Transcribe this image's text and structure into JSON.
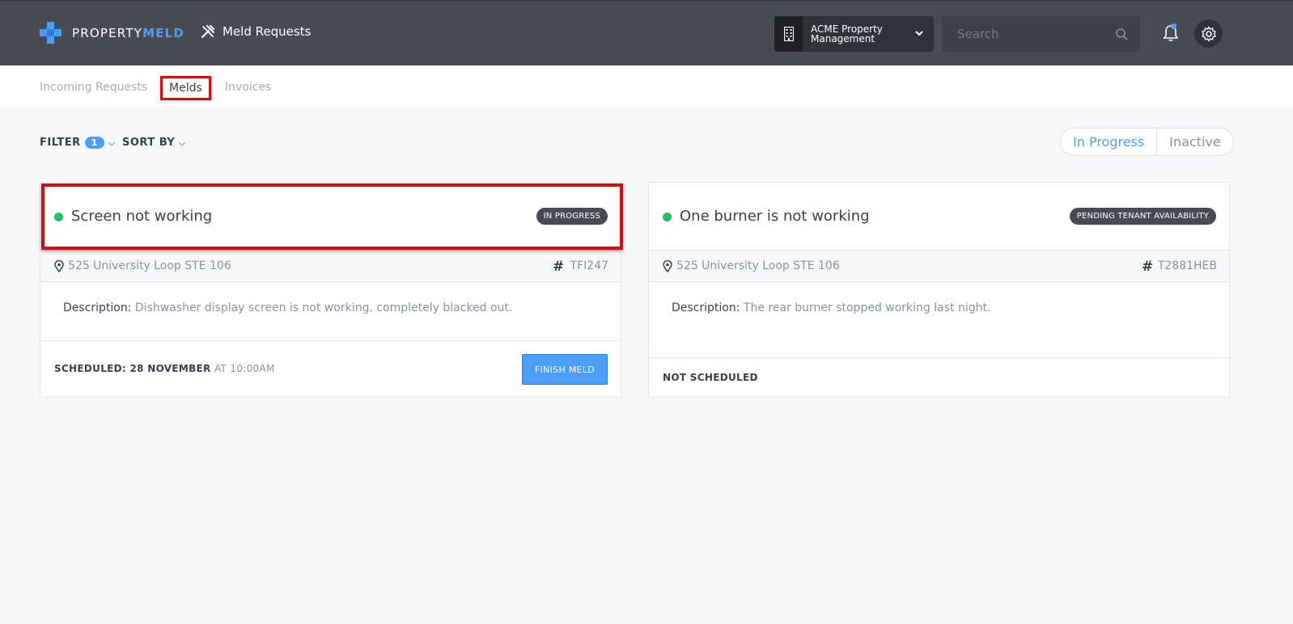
{
  "header": {
    "logo_prefix": "PROPERTY",
    "logo_suffix": "MELD",
    "app_title": "Meld Requests",
    "org_name": "ACME Property Management",
    "search_placeholder": "Search",
    "icons": [
      "tools-icon",
      "building-icon",
      "chevron-down-icon",
      "search-icon",
      "bell-icon",
      "gear-icon"
    ],
    "accent_color": "#4a9df8",
    "bar_color": "#484b54"
  },
  "subnav": {
    "tabs": [
      {
        "label": "Incoming Requests"
      },
      {
        "label": "Melds"
      },
      {
        "label": "Invoices"
      }
    ]
  },
  "toolbar": {
    "filter_label": "FILTER",
    "filter_count": "1",
    "sort_label": "SORT BY",
    "status_toggle": {
      "active": "In Progress",
      "inactive": "Inactive"
    }
  },
  "melds": [
    {
      "title": "Screen not working",
      "status": "IN PROGRESS",
      "address": "525 University Loop STE 106",
      "hash": "#",
      "code": "TFI247",
      "desc_label": "Description:",
      "description": "Dishwasher display screen is not working, completely blacked out.",
      "schedule_prefix": "SCHEDULED: 28 NOVEMBER",
      "schedule_suffix": "AT 10:00AM",
      "action_label": "FINISH MELD",
      "status_dot_color": "#1fc16a"
    },
    {
      "title": "One burner is not working",
      "status": "PENDING TENANT AVAILABILITY",
      "address": "525 University Loop STE 106",
      "hash": "#",
      "code": "T2881HEB",
      "desc_label": "Description:",
      "description": "The rear burner stopped working last night.",
      "schedule_prefix": "NOT SCHEDULED",
      "status_dot_color": "#1fc16a"
    }
  ]
}
